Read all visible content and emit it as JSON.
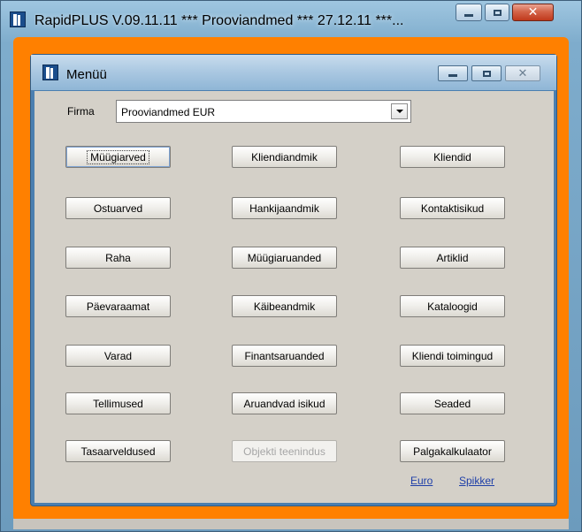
{
  "app": {
    "title": "RapidPLUS V.09.11.11 ***  Prooviandmed  ***  27.12.11  ***..."
  },
  "menu_window": {
    "title": "Menüü"
  },
  "firma": {
    "label": "Firma",
    "selected": "Prooviandmed  EUR"
  },
  "buttons": [
    [
      "Müügiarved",
      "Kliendiandmik",
      "Kliendid"
    ],
    [
      "Ostuarved",
      "Hankijaandmik",
      "Kontaktisikud"
    ],
    [
      "Raha",
      "Müügiaruanded",
      "Artiklid"
    ],
    [
      "Päevaraamat",
      "Käibeandmik",
      "Kataloogid"
    ],
    [
      "Varad",
      "Finantsaruanded",
      "Kliendi toimingud"
    ],
    [
      "Tellimused",
      "Aruandvad isikud",
      "Seaded"
    ],
    [
      "Tasaarveldused",
      "Objekti teenindus",
      "Palgakalkulaator"
    ]
  ],
  "button_states": {
    "focused": "Müügiarved",
    "disabled": [
      "Objekti teenindus"
    ]
  },
  "links": {
    "euro": "Euro",
    "spikker": "Spikker"
  },
  "colors": {
    "frame_accent": "#ff8000",
    "panel_bg": "#d4d0c8",
    "link": "#1f3fa8"
  },
  "icons": {
    "app_logo": "rapidplus-logo-icon",
    "minimize": "minimize-icon",
    "maximize": "maximize-icon",
    "close": "close-icon",
    "dropdown": "chevron-down-icon"
  }
}
